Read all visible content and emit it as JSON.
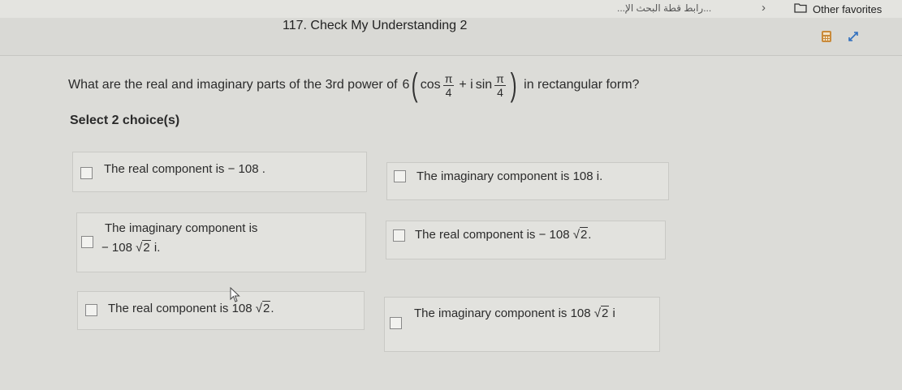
{
  "browser": {
    "bookmark_link": "...رابط قطة البحث الإ...",
    "bookmark_chevron": "›",
    "other_favorites": "Other favorites"
  },
  "page": {
    "title": "117. Check My Understanding 2"
  },
  "question": {
    "prefix": "What are the real and imaginary parts of the 3rd power of",
    "coefficient": "6",
    "open_paren": "(",
    "cos": "cos",
    "pi": "π",
    "denom": "4",
    "plus_i": "+ i",
    "sin": "sin",
    "close_paren": ")",
    "suffix": "in rectangular form?"
  },
  "instruction": "Select 2 choice(s)",
  "choices": [
    {
      "text_a": "The real component is − 108 .",
      "text_b": "",
      "radical": "",
      "text_c": ""
    },
    {
      "text_a": "The imaginary component is  108 i.",
      "text_b": "",
      "radical": "",
      "text_c": ""
    },
    {
      "text_a": "The imaginary component is",
      "text_b": "− 108",
      "radical": "2",
      "text_c": "i."
    },
    {
      "text_a": "The real component is − 108",
      "text_b": "",
      "radical": "2",
      "text_c": "."
    },
    {
      "text_a": "The real component is  108",
      "text_b": "",
      "radical": "2",
      "text_c": "."
    },
    {
      "text_a": "The imaginary component is  108",
      "text_b": "",
      "radical": "2",
      "text_c": "i"
    }
  ]
}
